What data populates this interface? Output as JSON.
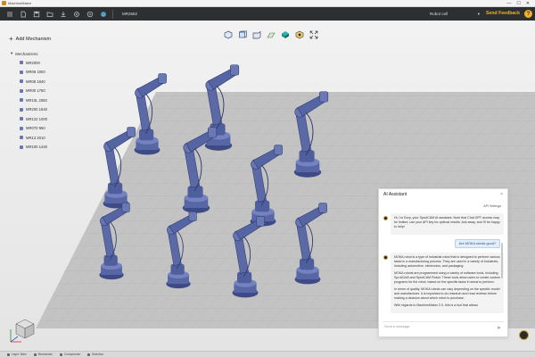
{
  "app": {
    "title": "MachineMaker"
  },
  "window_controls": [
    "—",
    "☐",
    "✕"
  ],
  "toolbar": {
    "icons": [
      "menu-icon",
      "new-file-icon",
      "save-icon",
      "open-folder-icon",
      "import-icon",
      "settings-icon",
      "plugin-icon",
      "globe-icon"
    ],
    "tab_name": "MR2582",
    "robot_select": "Robot cell",
    "send_feedback": "Send Feedback",
    "help": "?"
  },
  "view_tools": [
    "iso-view-icon",
    "front-view-icon",
    "side-view-icon",
    "grid-plane-icon",
    "shade-icon",
    "wireframe-icon",
    "fit-view-icon"
  ],
  "left_panel": {
    "add_label": "Add Mechanism",
    "section_label": "Mechanisms",
    "items": [
      "MR2000",
      "MR08 1900",
      "MR08 1840",
      "MR00 1750",
      "MR10L 2050",
      "MR200 1840",
      "MR122 1000",
      "MR070 950",
      "MR13 2010",
      "MR100 1440"
    ]
  },
  "ai_assistant": {
    "title": "AI Assistant",
    "close": "×",
    "api_settings": "API Settings",
    "greeting": "Hi, I'm Ezzy, your SprutCAM AI assistant. Note that Chat GPT access may be limited, use your API key for optimal results. Ask away, and I'll be happy to help!",
    "user_message": "Are MOKA robots good?",
    "reply_paragraphs": [
      "MOKA robot is a type of industrial robot that is designed to perform various tasks in a manufacturing process. They are used in a variety of industries, including automotive, electronics, and packaging.",
      "MOKA robots are programmed using a variety of software tools, including SprutCAM and SprutCAM Robot. These tools allow users to create custom programs for the robot, based on the specific tasks it needs to perform.",
      "In terms of quality, MOKA robots can vary depending on the specific model and manufacturer. It is important to do research and read reviews before making a decision about which robot to purchase.",
      "With regards to MachineMaker 2.0, this is a tool that allows"
    ],
    "input_placeholder": "Send a message",
    "send_icon": "send-icon"
  },
  "statusbar": {
    "items": [
      "Layer: Main",
      "Mechanism",
      "Components",
      "Selection"
    ]
  },
  "colors": {
    "toolbar_bg": "#2e2f31",
    "accent": "#f0b323",
    "robot_blue": "#5b6aa6",
    "floor": "#c3c3c3"
  }
}
